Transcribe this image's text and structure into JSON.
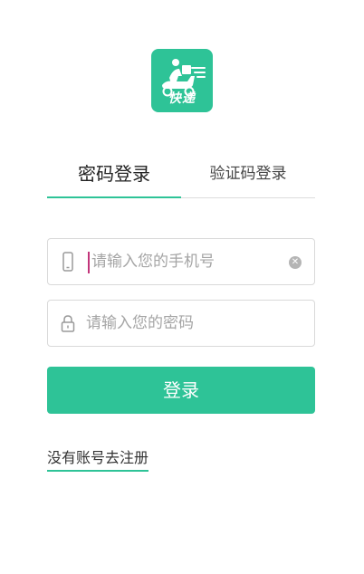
{
  "brand": {
    "logo_text": "快递",
    "accent_color": "#2ec397",
    "logo_icon": "delivery-scooter-icon"
  },
  "tabs": {
    "password_login": "密码登录",
    "code_login": "验证码登录"
  },
  "phone_field": {
    "placeholder": "请输入您的手机号",
    "value": "",
    "icon": "phone-icon",
    "clear_icon": "clear-icon"
  },
  "password_field": {
    "placeholder": "请输入您的密码",
    "value": "",
    "icon": "lock-icon"
  },
  "login_button": {
    "label": "登录"
  },
  "register_link": {
    "label": "没有账号去注册"
  }
}
